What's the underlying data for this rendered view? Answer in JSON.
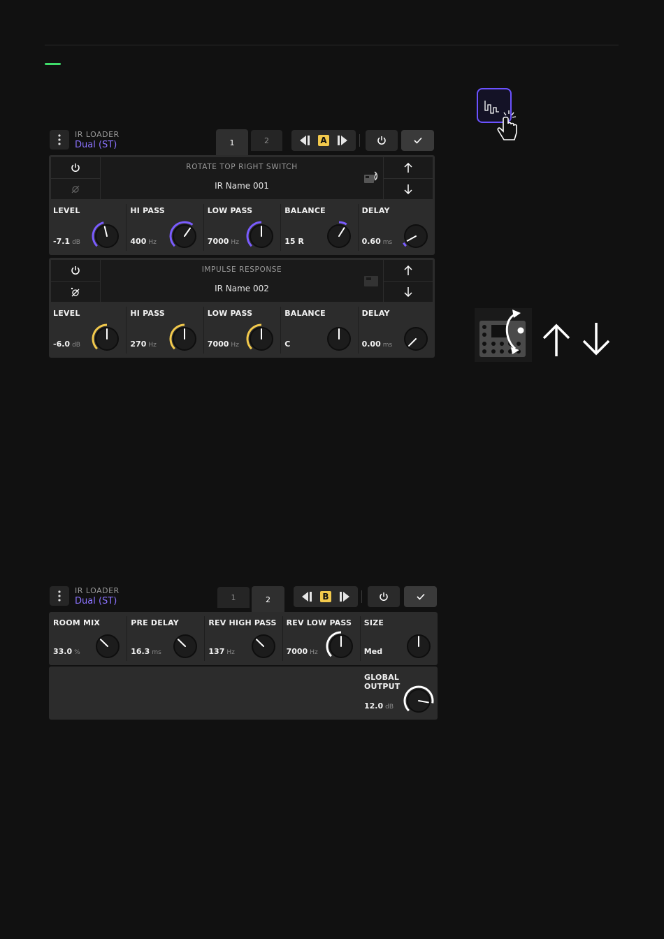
{
  "colors": {
    "accent_green": "#3fdc6a",
    "purple": "#7a5cff",
    "yellow": "#f2c94c",
    "background": "#111111",
    "panel": "#2c2c2c"
  },
  "screen1": {
    "title": "IR LOADER",
    "subtitle": "Dual (ST)",
    "tabs": [
      "1",
      "2"
    ],
    "preset_letter": "A",
    "ir1": {
      "label": "ROTATE TOP RIGHT SWITCH",
      "name": "IR Name 001",
      "knobs": [
        {
          "label": "LEVEL",
          "value": "-7.1",
          "unit": "dB",
          "fraction": 0.45
        },
        {
          "label": "HI PASS",
          "value": "400",
          "unit": "Hz",
          "fraction": 0.63
        },
        {
          "label": "LOW PASS",
          "value": "7000",
          "unit": "Hz",
          "fraction": 0.5
        },
        {
          "label": "BALANCE",
          "value": "15 R",
          "unit": "",
          "fraction": 0.62
        },
        {
          "label": "DELAY",
          "value": "0.60",
          "unit": "ms",
          "fraction": 0.06
        }
      ]
    },
    "ir2": {
      "label": "IMPULSE RESPONSE",
      "name": "IR Name 002",
      "knobs": [
        {
          "label": "LEVEL",
          "value": "-6.0",
          "unit": "dB",
          "fraction": 0.5
        },
        {
          "label": "HI PASS",
          "value": "270",
          "unit": "Hz",
          "fraction": 0.5
        },
        {
          "label": "LOW PASS",
          "value": "7000",
          "unit": "Hz",
          "fraction": 0.5
        },
        {
          "label": "BALANCE",
          "value": "C",
          "unit": "",
          "fraction": 0.5
        },
        {
          "label": "DELAY",
          "value": "0.00",
          "unit": "ms",
          "fraction": 0.0
        }
      ]
    }
  },
  "screen2": {
    "title": "IR LOADER",
    "subtitle": "Dual (ST)",
    "tabs": [
      "1",
      "2"
    ],
    "preset_letter": "B",
    "knobs": [
      {
        "label": "ROOM MIX",
        "value": "33.0",
        "unit": "%",
        "fraction": 0.33
      },
      {
        "label": "PRE DELAY",
        "value": "16.3",
        "unit": "ms",
        "fraction": 0.33
      },
      {
        "label": "REV HIGH PASS",
        "value": "137",
        "unit": "Hz",
        "fraction": 0.33
      },
      {
        "label": "REV LOW PASS",
        "value": "7000",
        "unit": "Hz",
        "fraction": 0.5
      },
      {
        "label": "SIZE",
        "value": "Med",
        "unit": "",
        "fraction": 0.5
      }
    ],
    "global_output": {
      "label": "GLOBAL OUTPUT",
      "value": "12.0",
      "unit": "dB",
      "fraction": 0.87
    }
  }
}
